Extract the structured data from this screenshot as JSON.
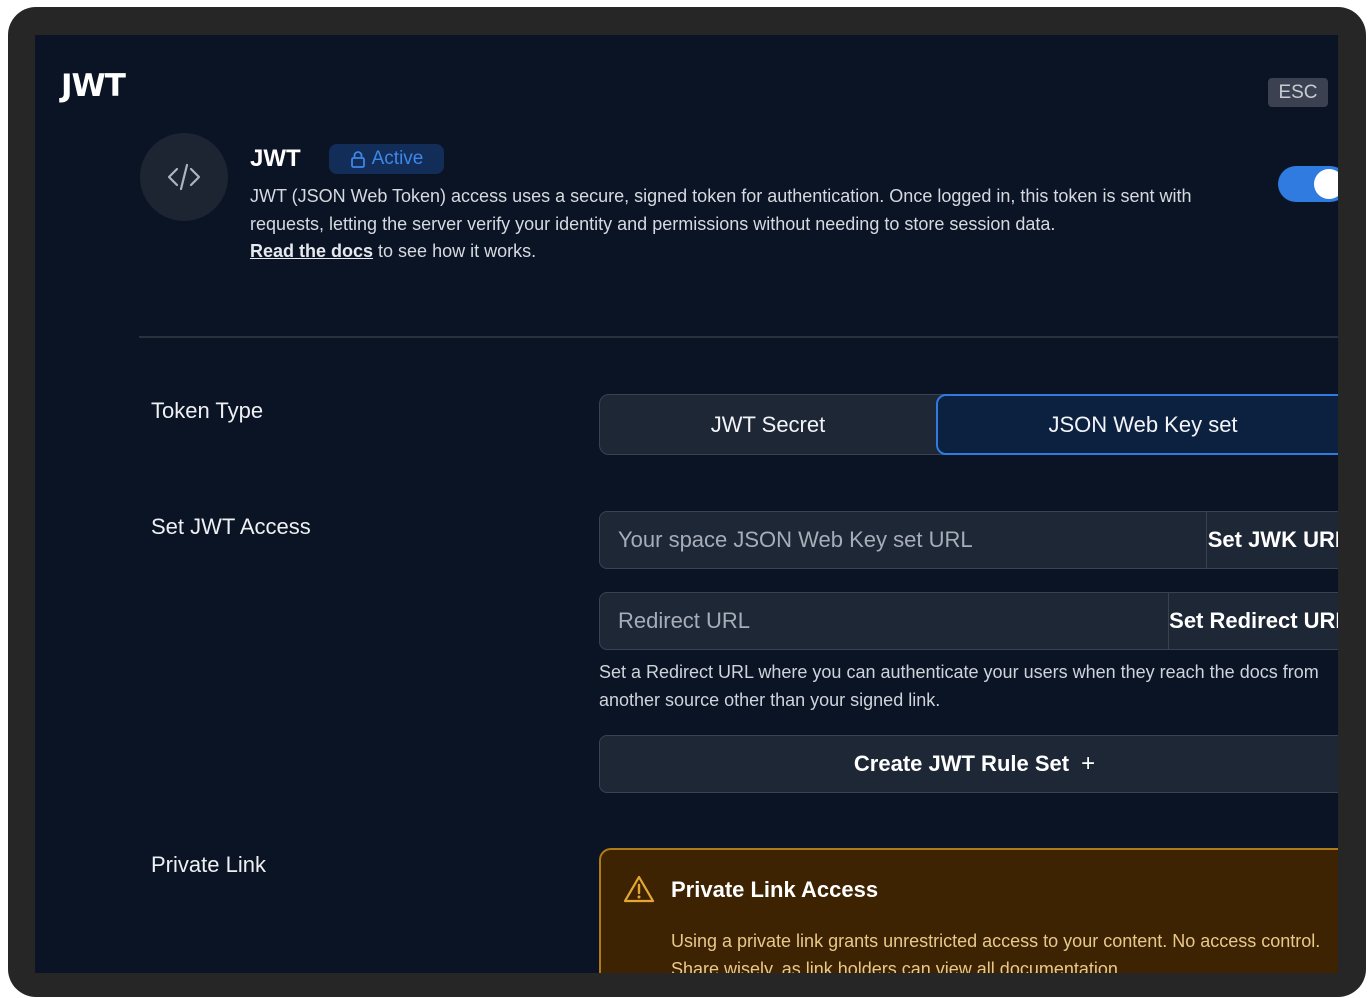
{
  "modal": {
    "title": "JWT",
    "esc_label": "ESC",
    "close_symbol": "×"
  },
  "header": {
    "title": "JWT",
    "badge": "Active",
    "badge_icon": "lock-icon",
    "description": "JWT (JSON Web Token) access uses a secure, signed token for authentication. Once logged in, this token is sent with requests, letting the server verify your identity and permissions without needing to store session data.",
    "docs_link": "Read the docs",
    "docs_suffix": " to see how it works.",
    "toggle_on": true
  },
  "token_type": {
    "label": "Token Type",
    "options": [
      "JWT Secret",
      "JSON Web Key set"
    ],
    "selected": "JSON Web Key set"
  },
  "jwt_access": {
    "label": "Set JWT Access",
    "jwk_placeholder": "Your space JSON Web Key set URL",
    "jwk_button": "Set JWK URL",
    "redirect_placeholder": "Redirect URL",
    "redirect_button": "Set Redirect URL",
    "helper": "Set a Redirect URL where you can authenticate your users when they reach the docs from another source other than your signed link.",
    "create_button": "Create JWT Rule Set",
    "create_symbol": "+"
  },
  "private_link": {
    "label": "Private Link",
    "warning_title": "Private Link Access",
    "warning_body": "Using a private link grants unrestricted access to your content. No access control. Share wisely, as link holders can view all documentation"
  },
  "colors": {
    "background": "#0b1425",
    "accent": "#2f7be0",
    "warning_bg": "#3e2303",
    "warning_border": "#b07a17"
  }
}
